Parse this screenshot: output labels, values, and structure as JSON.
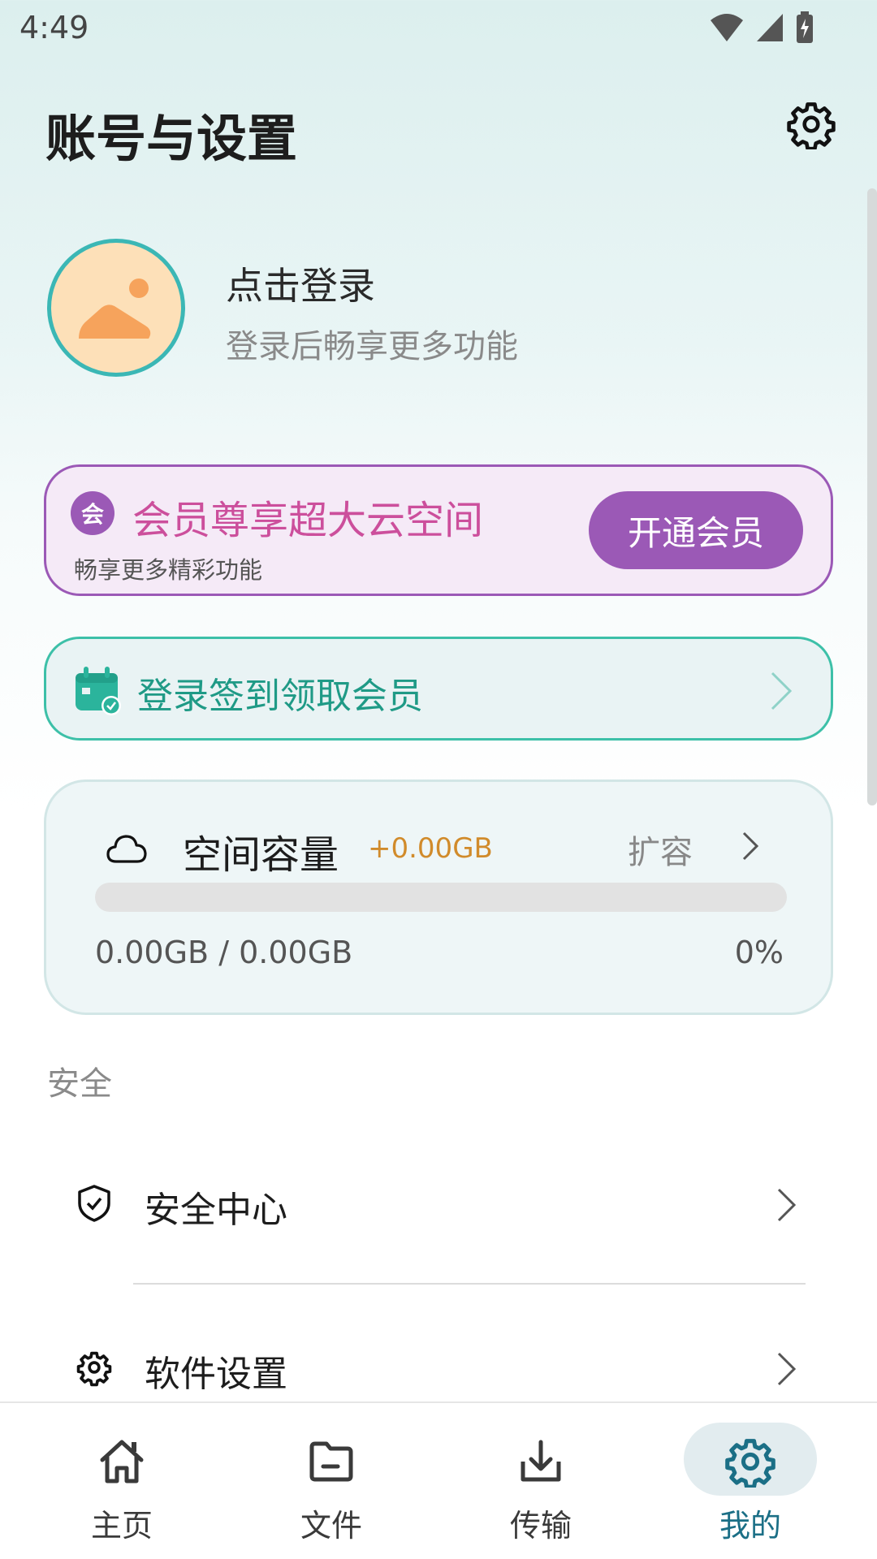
{
  "status_bar": {
    "time": "4:49"
  },
  "header": {
    "title": "账号与设置"
  },
  "profile": {
    "title": "点击登录",
    "subtitle": "登录后畅享更多功能"
  },
  "vip": {
    "badge": "会",
    "title": "会员尊享超大云空间",
    "subtitle": "畅享更多精彩功能",
    "button_label": "开通会员"
  },
  "checkin": {
    "label": "登录签到领取会员"
  },
  "storage": {
    "title": "空间容量",
    "extra": "+0.00GB",
    "expand_label": "扩容",
    "usage": "0.00GB / 0.00GB",
    "percent_label": "0%",
    "percent": 0
  },
  "sections": [
    {
      "label": "安全",
      "items": [
        {
          "label": "安全中心",
          "icon": "shield-check-icon"
        },
        {
          "label": "软件设置",
          "icon": "gear-icon"
        }
      ]
    }
  ],
  "bottom_nav": [
    {
      "label": "主页",
      "icon": "home-icon",
      "active": false
    },
    {
      "label": "文件",
      "icon": "folder-icon",
      "active": false
    },
    {
      "label": "传输",
      "icon": "download-icon",
      "active": false
    },
    {
      "label": "我的",
      "icon": "gear-icon",
      "active": true
    }
  ],
  "colors": {
    "accent": "#3bb7b5",
    "vip_purple": "#9b59b6",
    "vip_title": "#cc4f9c",
    "checkin_green": "#1f9a86",
    "storage_extra": "#d18b2b",
    "nav_active": "#1b6f86"
  }
}
